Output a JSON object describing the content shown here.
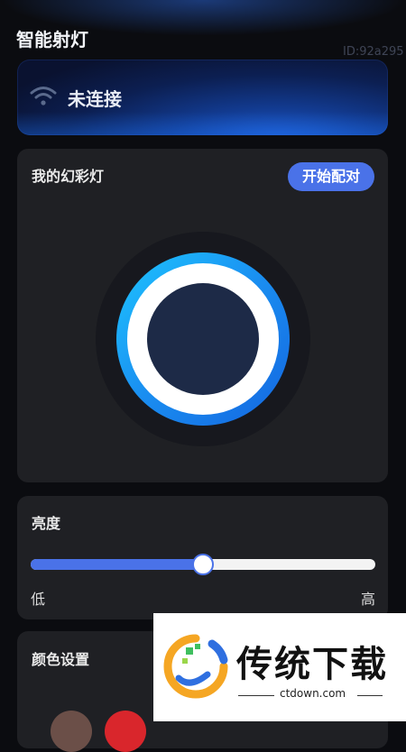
{
  "header": {
    "title": "智能射灯",
    "device_id": "ID:92a295"
  },
  "connection": {
    "icon": "wifi-icon",
    "status": "未连接"
  },
  "lamp_card": {
    "title": "我的幻彩灯",
    "pair_button": "开始配对",
    "ring_colors": [
      "#1ec5ff",
      "#1466e0"
    ]
  },
  "brightness": {
    "title": "亮度",
    "value_fraction": 0.5,
    "low_label": "低",
    "high_label": "高"
  },
  "color_settings": {
    "title": "颜色设置",
    "swatches": [
      "#6b4f48",
      "#d9262c"
    ]
  },
  "watermark": {
    "brand": "传统下载",
    "url": "ctdown.com"
  },
  "colors": {
    "accent": "#4a72e8",
    "card_bg": "#1f2024",
    "page_bg": "#0b0c10"
  }
}
